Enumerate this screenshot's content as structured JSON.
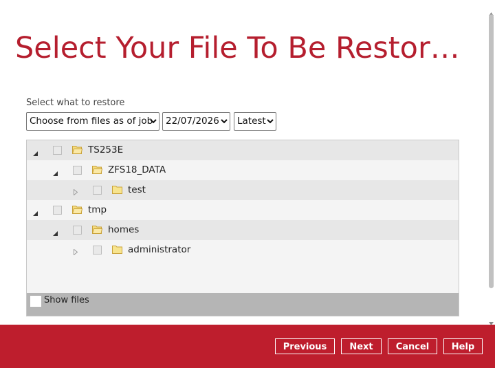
{
  "title": "Select Your File To Be Restor…",
  "restore_section": {
    "label": "Select what to restore",
    "mode_select": "Choose from files as of job",
    "date_select": "22/07/2026",
    "version_select": "Latest"
  },
  "tree": {
    "nodes": [
      {
        "label": "TS253E",
        "level": 0,
        "expanded": true,
        "folder": "open"
      },
      {
        "label": "ZFS18_DATA",
        "level": 1,
        "expanded": true,
        "folder": "open"
      },
      {
        "label": "test",
        "level": 2,
        "expanded": false,
        "folder": "closed"
      },
      {
        "label": "tmp",
        "level": 0,
        "expanded": true,
        "folder": "open"
      },
      {
        "label": "homes",
        "level": 1,
        "expanded": true,
        "folder": "open"
      },
      {
        "label": "administrator",
        "level": 2,
        "expanded": false,
        "folder": "closed"
      }
    ],
    "show_files_label": "Show files"
  },
  "footer": {
    "previous": "Previous",
    "next": "Next",
    "cancel": "Cancel",
    "help": "Help"
  },
  "colors": {
    "accent": "#be1e2d",
    "title": "#b51e2e",
    "folder": "#f4dc82"
  }
}
